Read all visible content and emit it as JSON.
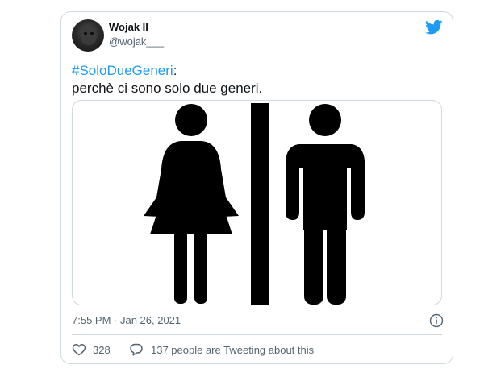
{
  "author": {
    "display_name": "Wojak II",
    "handle": "@wojak___"
  },
  "tweet": {
    "hashtag": "#SoloDueGeneri",
    "hashtag_suffix": ":",
    "text_line2": "perchè ci sono solo due generi.",
    "timestamp": "7:55 PM · Jan 26, 2021"
  },
  "actions": {
    "like_count": "328",
    "discussion_text": "137 people are Tweeting about this"
  },
  "colors": {
    "accent": "#1d9bf0",
    "secondary_text": "#536471",
    "border": "#cfd9de"
  },
  "icons": [
    "twitter-bird-icon",
    "info-icon",
    "heart-icon",
    "comment-bubble-icon"
  ]
}
